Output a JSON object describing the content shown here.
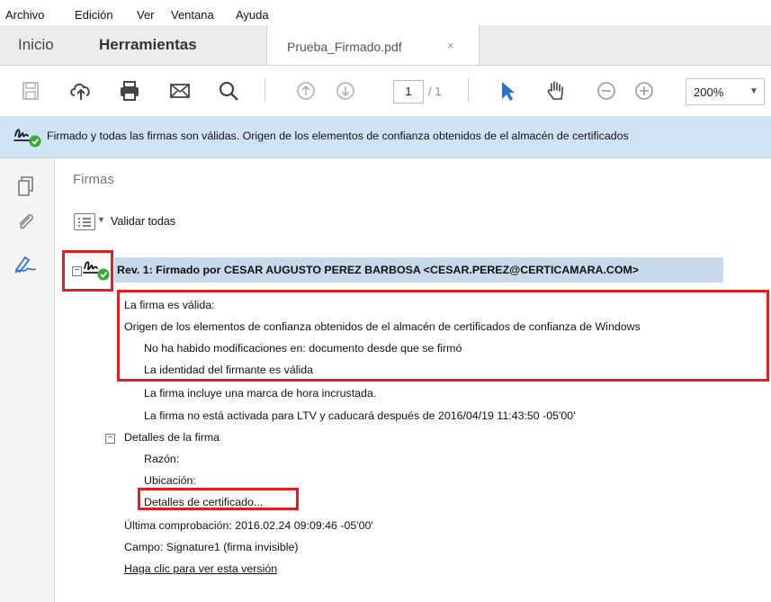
{
  "menu": [
    "Archivo",
    "Edición",
    "Ver",
    "Ventana",
    "Ayuda"
  ],
  "tabs": {
    "home": "Inicio",
    "tools": "Herramientas",
    "document": "Prueba_Firmado.pdf",
    "close_glyph": "×"
  },
  "toolbar": {
    "current_page": "1",
    "total_pages": "/ 1",
    "zoom": "200%",
    "zoom_caret": "▼",
    "icons": [
      "save-icon",
      "cloud-upload-icon",
      "print-icon",
      "email-icon",
      "search-icon",
      "page-up-icon",
      "page-down-icon",
      "select-arrow-icon",
      "hand-icon",
      "zoom-out-icon",
      "zoom-in-icon"
    ]
  },
  "signature_bar": {
    "message": "Firmado y todas las firmas son válidas. Origen de los elementos de confianza obtenidos de el almacén de certificados"
  },
  "panel": {
    "title": "Firmas",
    "validate_all": "Validar todas",
    "revision": {
      "label": "Rev. 1: Firmado por CESAR AUGUSTO PEREZ BARBOSA <CESAR.PEREZ@CERTICAMARA.COM>",
      "lines": [
        "La firma es válida:",
        "Origen de los elementos de confianza obtenidos de el almacén de certificados de confianza de Windows",
        "No ha habido modificaciones en: documento desde que se firmó",
        "La identidad del firmante es válida",
        "La firma incluye una marca de hora incrustada.",
        "La firma no está activada para LTV y caducará después de 2016/04/19 11:43:50 -05'00'"
      ],
      "details": {
        "title": "Detalles de la firma",
        "reason": "Razón:",
        "location": "Ubicación:",
        "certificate_link": "Detalles de certificado..."
      },
      "last_check": "Última comprobación: 2016.02.24 09:09:46 -05'00'",
      "field": "Campo: Signature1 (firma invisible)",
      "view_version_link": "Haga clic para ver esta versión"
    }
  },
  "colors": {
    "highlight_red": "#dd1f26",
    "info_bar_blue": "#cfe3f6",
    "selection_blue": "#c7d9ec",
    "valid_green": "#3aa935",
    "accent_blue": "#2a73c8"
  }
}
